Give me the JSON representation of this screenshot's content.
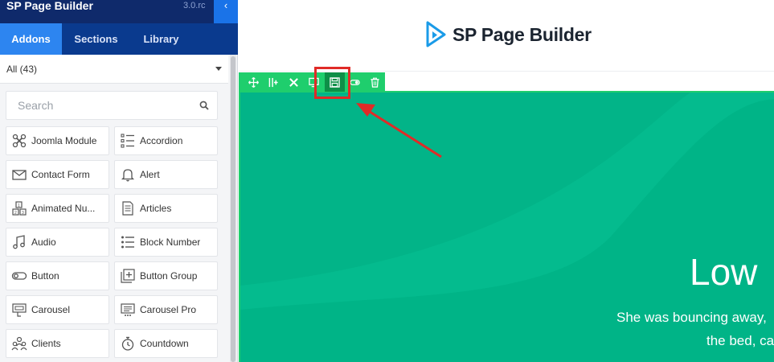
{
  "app": {
    "title": "SP Page Builder",
    "version": "3.0.rc",
    "collapse_icon": "chevron-left-icon"
  },
  "tabs": [
    {
      "label": "Addons",
      "active": true
    },
    {
      "label": "Sections",
      "active": false
    },
    {
      "label": "Library",
      "active": false
    }
  ],
  "filter": {
    "selected": "All (43)"
  },
  "search": {
    "placeholder": "Search",
    "icon": "search-icon"
  },
  "addons": [
    {
      "label": "Joomla Module",
      "icon": "joomla-icon"
    },
    {
      "label": "Accordion",
      "icon": "accordion-icon"
    },
    {
      "label": "Contact Form",
      "icon": "envelope-icon"
    },
    {
      "label": "Alert",
      "icon": "bell-icon"
    },
    {
      "label": "Animated Nu...",
      "icon": "number-blocks-icon"
    },
    {
      "label": "Articles",
      "icon": "document-icon"
    },
    {
      "label": "Audio",
      "icon": "music-note-icon"
    },
    {
      "label": "Block Number",
      "icon": "numbered-list-icon"
    },
    {
      "label": "Button",
      "icon": "toggle-icon"
    },
    {
      "label": "Button Group",
      "icon": "add-box-icon"
    },
    {
      "label": "Carousel",
      "icon": "carousel-icon"
    },
    {
      "label": "Carousel Pro",
      "icon": "carousel-pro-icon"
    },
    {
      "label": "Clients",
      "icon": "clients-icon"
    },
    {
      "label": "Countdown",
      "icon": "stopwatch-icon"
    }
  ],
  "canvas": {
    "brand": "SP Page Builder",
    "toolbar_icons": [
      "move-icon",
      "columns-icon",
      "settings-icon",
      "monitor-icon",
      "save-icon",
      "toggle-visibility-icon",
      "trash-icon"
    ],
    "hero": {
      "title": "Low",
      "subtitle_line1": "She was bouncing away,",
      "subtitle_line2": "the bed, ca"
    }
  },
  "colors": {
    "sidebar_header": "#0f2a6b",
    "tab_bar": "#0a3a8e",
    "tab_active": "#2d85f0",
    "toolbar": "#1fce6d",
    "hero": "#00b487",
    "highlight": "#e02b27"
  }
}
